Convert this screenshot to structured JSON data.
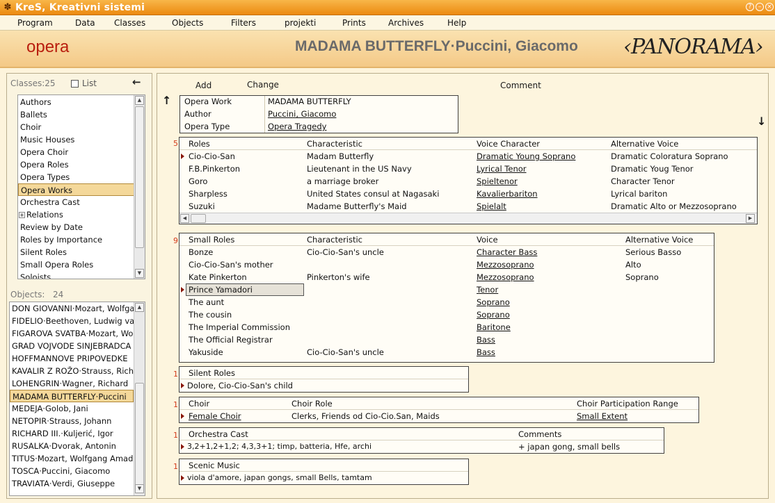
{
  "app": {
    "title": "KreS, Kreativni sistemi"
  },
  "colors": {
    "accent": "#ec8a10",
    "category": "#b91e0e",
    "marker": "#8b1a0e",
    "counts": "#d23a1a"
  },
  "menu": [
    "Program",
    "Data",
    "Classes",
    "Objects",
    "Filters",
    "projekti",
    "Prints",
    "Archives",
    "Help"
  ],
  "header": {
    "category": "opera",
    "title": "MADAMA BUTTERFLY·Puccini, Giacomo",
    "logo": "PANORAMA"
  },
  "classes": {
    "label": "Classes:25",
    "list_label": "List",
    "items": [
      "Authors",
      "Ballets",
      "Choir",
      "Music Houses",
      "Opera Choir",
      "Opera Roles",
      "Opera Types",
      "Opera Works",
      "Orchestra Cast",
      "Relations",
      "Review by Date",
      "Roles by Importance",
      "Silent Roles",
      "Small Opera Roles",
      "Soloists"
    ],
    "selected": "Opera Works",
    "expandable": "Relations"
  },
  "objects": {
    "label": "Objects:",
    "count": "24",
    "items": [
      "DON GIOVANNI·Mozart, Wolfgang",
      "FIDELIO·Beethoven, Ludwig van",
      "FIGAROVA SVATBA·Mozart, Wolfgang",
      "GRAD VOJVODE SINJEBRADCA",
      "HOFFMANNOVE PRIPOVEDKE",
      "KAVALIR Z ROŽO·Strauss, Richard",
      "LOHENGRIN·Wagner, Richard",
      "MADAMA BUTTERFLY·Puccini",
      "MEDEJA·Golob, Jani",
      "NETOPIR·Strauss, Johann",
      "RICHARD III.·Kuljerić, Igor",
      "RUSALKA·Dvorak, Antonin",
      "TITUS·Mozart, Wolfgang Amadeus",
      "TOSCA·Puccini, Giacomo",
      "TRAVIATA·Verdi, Giuseppe"
    ],
    "selected": "MADAMA BUTTERFLY·Pucci"
  },
  "toolbar": {
    "add": "Add",
    "change": "Change",
    "comment": "Comment"
  },
  "work": {
    "rows": [
      {
        "label": "Opera Work",
        "value": "MADAMA BUTTERFLY"
      },
      {
        "label": "Author",
        "value": "Puccini, Giacomo"
      },
      {
        "label": "Opera Type",
        "value": "Opera Tragedy"
      }
    ]
  },
  "roles": {
    "count": "5",
    "headers": [
      "Roles",
      "Characteristic",
      "Voice Character",
      "Alternative Voice"
    ],
    "rows": [
      [
        "Cio-Cio-San",
        "Madam Butterfly",
        "Dramatic Young Soprano",
        "Dramatic Coloratura Soprano"
      ],
      [
        "F.B.Pinkerton",
        "Lieutenant in the US Navy",
        "Lyrical Tenor",
        "Dramatic Youg Tenor"
      ],
      [
        "Goro",
        "a marriage broker",
        "Spieltenor",
        "Character Tenor"
      ],
      [
        "Sharpless",
        "United States consul at Nagasaki",
        "Kavalierbariton",
        "Lyrical bariton"
      ],
      [
        "Suzuki",
        "Madame Butterfly's Maid",
        "Spielalt",
        "Dramatic Alto or Mezzosoprano"
      ]
    ]
  },
  "small_roles": {
    "count": "9",
    "headers": [
      "Small Roles",
      "Characteristic",
      "Voice",
      "Alternative Voice"
    ],
    "rows": [
      [
        "Bonze",
        "Cio-Cio-San's uncle",
        "Character Bass",
        "Serious Basso"
      ],
      [
        "Cio-Cio-San's mother",
        "",
        "Mezzosoprano",
        "Alto"
      ],
      [
        "Kate Pinkerton",
        "Pinkerton's wife",
        "Mezzosoprano",
        "Soprano"
      ],
      [
        "Prince Yamadori",
        "",
        "Tenor",
        ""
      ],
      [
        "The aunt",
        "",
        "Soprano",
        ""
      ],
      [
        "The cousin",
        "",
        "Soprano",
        ""
      ],
      [
        "The Imperial Commission",
        "",
        "Baritone",
        ""
      ],
      [
        "The Official Registrar",
        "",
        "Bass",
        ""
      ],
      [
        "Yakuside",
        "Cio-Cio-San's uncle",
        "Bass",
        ""
      ]
    ]
  },
  "silent_roles": {
    "count": "1",
    "header": "Silent Roles",
    "value": "Dolore, Cio-Cio-San's child"
  },
  "choir": {
    "count": "1",
    "headers": [
      "Choir",
      "Choir Role",
      "Choir Participation Range"
    ],
    "row": [
      "Female Choir",
      "Clerks, Friends od Cio-Cio.San, Maids",
      "Small Extent"
    ]
  },
  "orchestra": {
    "count": "1",
    "headers": [
      "Orchestra Cast",
      "Comments"
    ],
    "row": [
      "3,2+1,2+1,2;  4,3,3+1;  timp, batteria, Hfe, archi",
      "+ japan gong, small bells"
    ]
  },
  "scenic": {
    "count": "1",
    "header": "Scenic Music",
    "value": "viola d'amore, japan gongs, small Bells, tamtam"
  }
}
